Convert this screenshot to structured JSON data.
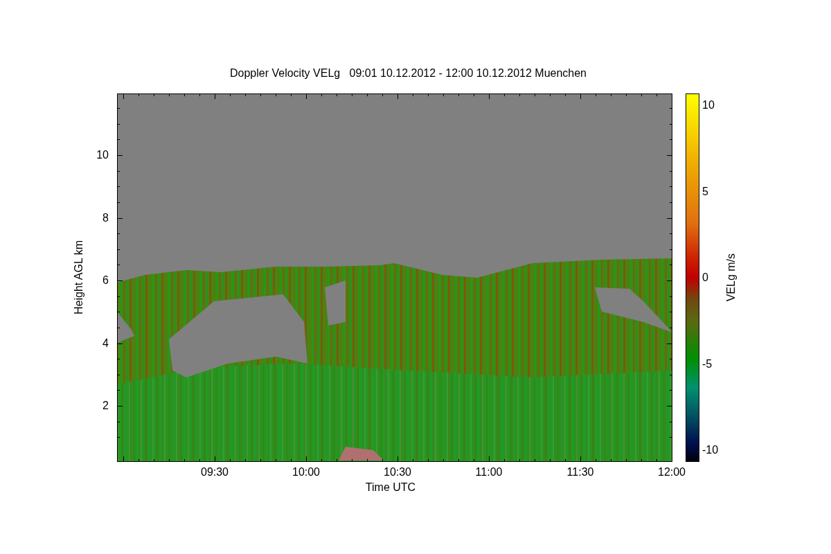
{
  "chart": {
    "title": "Doppler Velocity VELg   09:01 10.12.2012 - 12:00 10.12.2012 Muenchen",
    "ylabel": "Height AGL km",
    "xlabel": "Time UTC",
    "y_tick_labels": [
      "10",
      "8",
      "6",
      "4",
      "2"
    ],
    "x_tick_labels": [
      "09:30",
      "10:00",
      "10:30",
      "11:00",
      "11:30",
      "12:00"
    ]
  },
  "colorbar": {
    "label": "VELg m/s",
    "tick_labels": [
      "10",
      "5",
      "0",
      "-5",
      "-10"
    ]
  }
}
